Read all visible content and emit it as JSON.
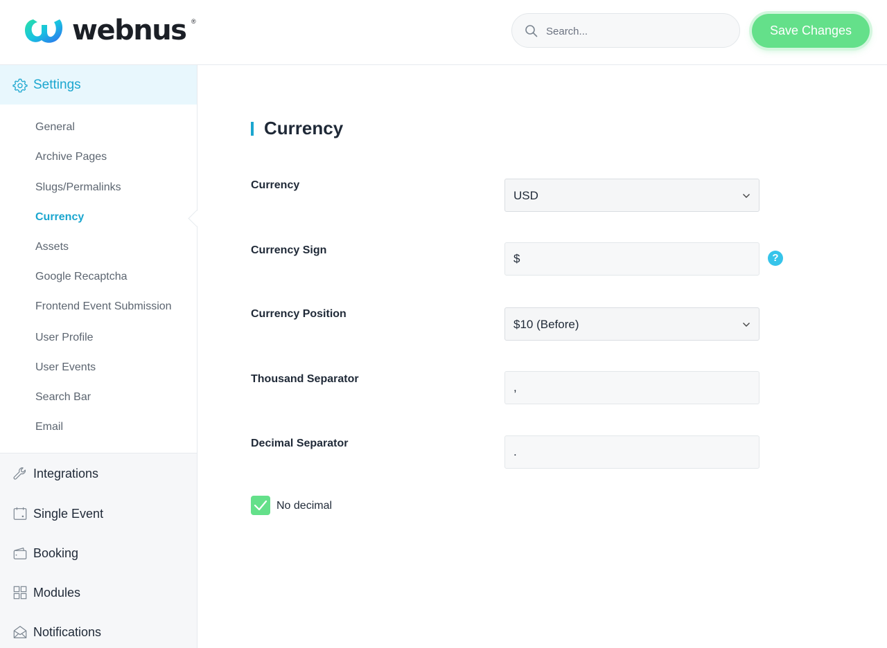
{
  "header": {
    "brand": "webnus",
    "search_placeholder": "Search...",
    "save_label": "Save Changes"
  },
  "sidebar": {
    "settings_label": "Settings",
    "sub_items": [
      {
        "label": "General",
        "active": false
      },
      {
        "label": "Archive Pages",
        "active": false
      },
      {
        "label": "Slugs/Permalinks",
        "active": false
      },
      {
        "label": "Currency",
        "active": true
      },
      {
        "label": "Assets",
        "active": false
      },
      {
        "label": "Google Recaptcha",
        "active": false
      },
      {
        "label": "Frontend Event Submission",
        "active": false
      },
      {
        "label": "User Profile",
        "active": false
      },
      {
        "label": "User Events",
        "active": false
      },
      {
        "label": "Search Bar",
        "active": false
      },
      {
        "label": "Email",
        "active": false
      }
    ],
    "main_items": [
      {
        "label": "Integrations",
        "icon": "wrench-icon"
      },
      {
        "label": "Single Event",
        "icon": "calendar-icon"
      },
      {
        "label": "Booking",
        "icon": "wallet-icon"
      },
      {
        "label": "Modules",
        "icon": "grid-icon"
      },
      {
        "label": "Notifications",
        "icon": "envelope-icon"
      }
    ]
  },
  "content": {
    "title": "Currency",
    "fields": {
      "currency": {
        "label": "Currency",
        "value": "USD"
      },
      "currency_sign": {
        "label": "Currency Sign",
        "value": "$"
      },
      "currency_position": {
        "label": "Currency Position",
        "value": "$10 (Before)"
      },
      "thousand_separator": {
        "label": "Thousand Separator",
        "value": ","
      },
      "decimal_separator": {
        "label": "Decimal Separator",
        "value": "."
      }
    },
    "no_decimal": {
      "label": "No decimal",
      "checked": true
    },
    "help_glyph": "?"
  },
  "colors": {
    "accent": "#1ba6cf",
    "save_button": "#64e08a",
    "help_icon": "#36c4ea"
  }
}
